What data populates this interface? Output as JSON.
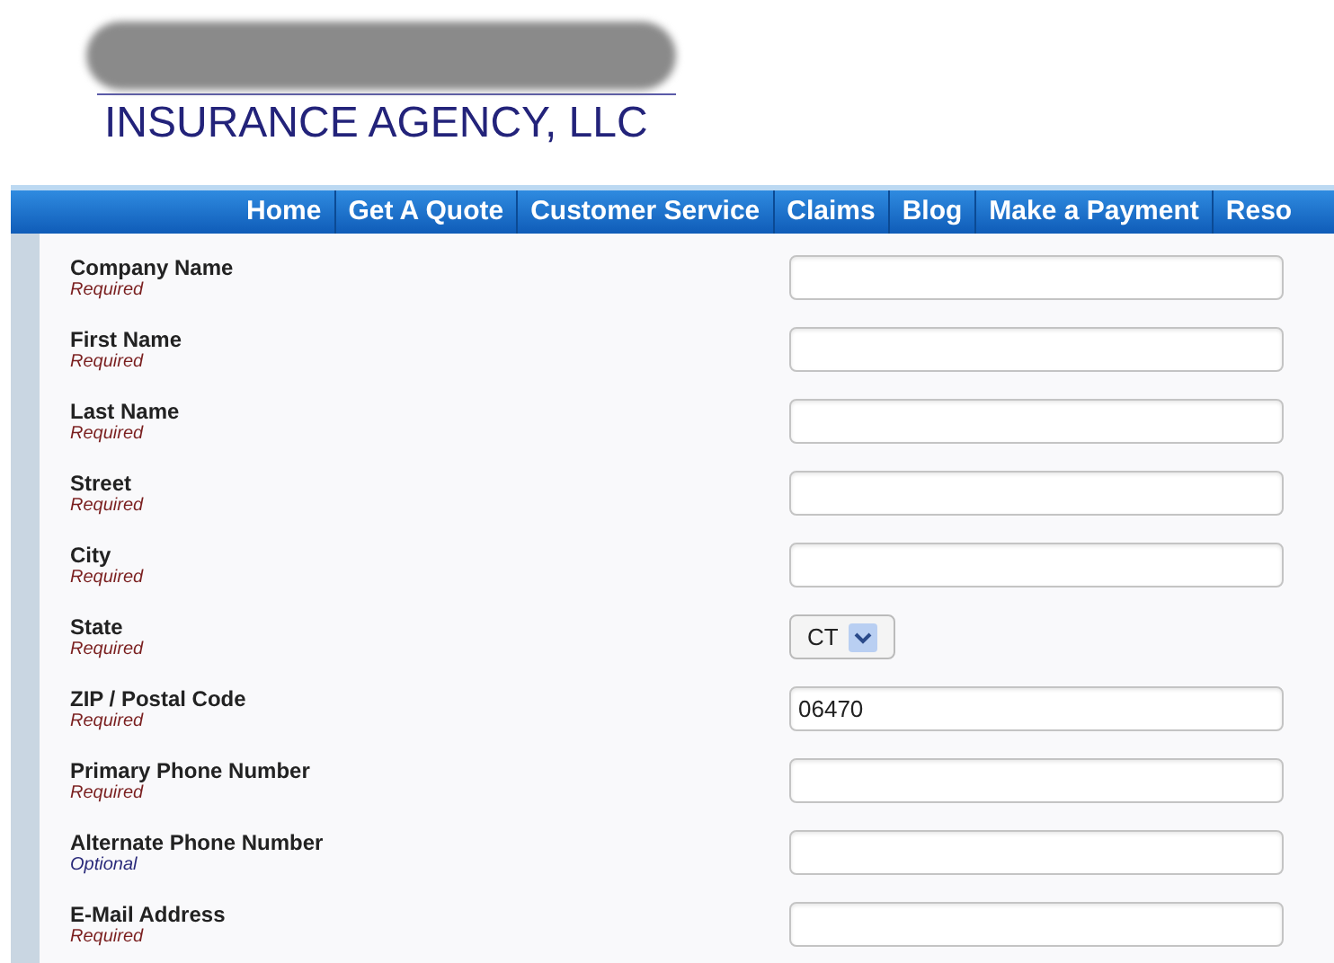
{
  "logo": {
    "subtitle": "INSURANCE AGENCY, LLC"
  },
  "nav": [
    {
      "label": "Home"
    },
    {
      "label": "Get A Quote"
    },
    {
      "label": "Customer Service"
    },
    {
      "label": "Claims"
    },
    {
      "label": "Blog"
    },
    {
      "label": "Make a Payment"
    },
    {
      "label": "Reso"
    }
  ],
  "fields": [
    {
      "label": "Company Name",
      "note": "Required",
      "required": true,
      "kind": "text"
    },
    {
      "label": "First Name",
      "note": "Required",
      "required": true,
      "kind": "text"
    },
    {
      "label": "Last Name",
      "note": "Required",
      "required": true,
      "kind": "text"
    },
    {
      "label": "Street",
      "note": "Required",
      "required": true,
      "kind": "text"
    },
    {
      "label": "City",
      "note": "Required",
      "required": true,
      "kind": "text"
    },
    {
      "label": "State",
      "note": "Required",
      "required": true,
      "kind": "select",
      "value": "CT"
    },
    {
      "label": "ZIP / Postal Code",
      "note": "Required",
      "required": true,
      "kind": "text",
      "value": "06470"
    },
    {
      "label": "Primary Phone Number",
      "note": "Required",
      "required": true,
      "kind": "text"
    },
    {
      "label": "Alternate Phone Number",
      "note": "Optional",
      "required": false,
      "kind": "text"
    },
    {
      "label": "E-Mail Address",
      "note": "Required",
      "required": true,
      "kind": "text"
    }
  ]
}
